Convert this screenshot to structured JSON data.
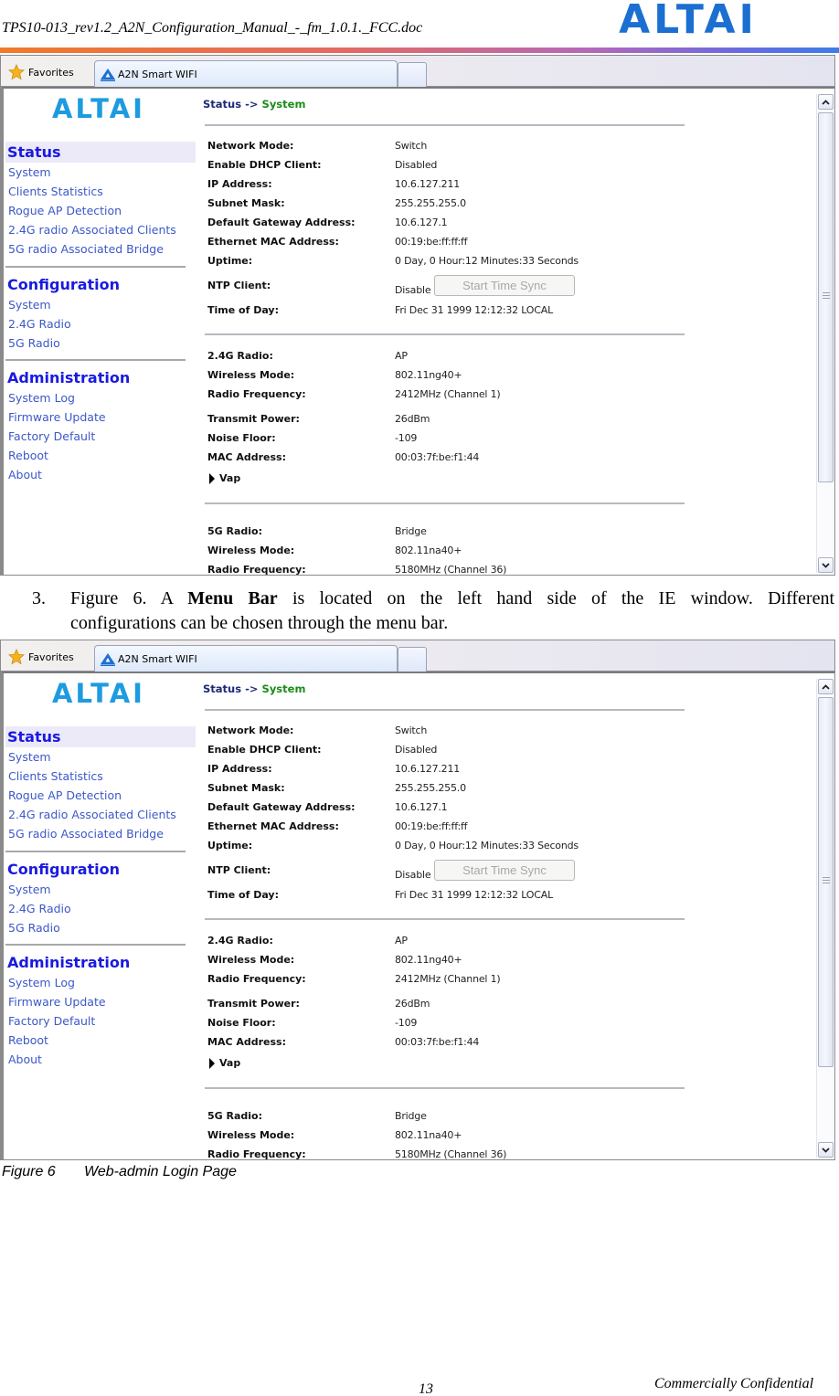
{
  "document": {
    "header_title": "TPS10-013_rev1.2_A2N_Configuration_Manual_-_fm_1.0.1._FCC.doc",
    "logo_text": "ALTAI",
    "step_number": "3.",
    "step_text_before": "Figure 6. A ",
    "step_text_bold": "Menu Bar",
    "step_text_after_line1": " is located on the left hand side of the IE window. Different",
    "step_text_line2": "configurations can be chosen through the menu bar.",
    "caption_number": "Figure 6",
    "caption_text": "Web-admin Login Page",
    "page_number": "13",
    "footer_note": "Commercially Confidential"
  },
  "colors": {
    "brand_blue": "#1e9be0",
    "section_title": "#1a1ae0",
    "menu_link": "#3c58c8",
    "breadcrumb_current": "#1a8c1a"
  },
  "browser": {
    "favorites_label": "Favorites",
    "tab_title": "A2N Smart WIFI",
    "icons": {
      "favorites": "star-icon",
      "tab": "altai-a-icon"
    }
  },
  "sidebar": {
    "logo_text": "ALTAI",
    "sections": [
      {
        "title": "Status",
        "active": true,
        "items": [
          "System",
          "Clients Statistics",
          "Rogue AP Detection",
          "2.4G radio Associated Clients",
          "5G radio Associated Bridge"
        ]
      },
      {
        "title": "Configuration",
        "items": [
          "System",
          "2.4G Radio",
          "5G Radio"
        ]
      },
      {
        "title": "Administration",
        "items": [
          "System Log",
          "Firmware Update",
          "Factory Default",
          "Reboot",
          "About"
        ]
      }
    ]
  },
  "content": {
    "breadcrumb": {
      "root": "Status",
      "separator": "->",
      "current": "System"
    },
    "system_rows": [
      {
        "label": "Network Mode:",
        "value": "Switch"
      },
      {
        "label": "Enable DHCP Client:",
        "value": "Disabled"
      },
      {
        "label": "IP Address:",
        "value": "10.6.127.211"
      },
      {
        "label": "Subnet Mask:",
        "value": "255.255.255.0"
      },
      {
        "label": "Default Gateway Address:",
        "value": "10.6.127.1"
      },
      {
        "label": "Ethernet MAC Address:",
        "value": "00:19:be:ff:ff:ff"
      },
      {
        "label": "Uptime:",
        "value": "0 Day, 0 Hour:12 Minutes:33 Seconds"
      }
    ],
    "ntp": {
      "label": "NTP Client:",
      "value": "Disable",
      "button_label": "Start Time Sync"
    },
    "time_of_day": {
      "label": "Time of Day:",
      "value": "Fri Dec 31 1999 12:12:32 LOCAL"
    },
    "radio_24g_rows": [
      {
        "label": "2.4G Radio:",
        "value": "AP"
      },
      {
        "label": "Wireless Mode:",
        "value": "802.11ng40+"
      },
      {
        "label": "Radio Frequency:",
        "value": "2412MHz (Channel 1)"
      },
      {
        "label": "Transmit Power:",
        "value": "26dBm"
      },
      {
        "label": "Noise Floor:",
        "value": "-109"
      },
      {
        "label": "MAC Address:",
        "value": "00:03:7f:be:f1:44"
      }
    ],
    "vap_label": "Vap",
    "radio_5g_rows": [
      {
        "label": "5G Radio:",
        "value": "Bridge"
      },
      {
        "label": "Wireless Mode:",
        "value": "802.11na40+"
      },
      {
        "label": "Radio Frequency:",
        "value": "5180MHz (Channel 36)"
      }
    ]
  }
}
